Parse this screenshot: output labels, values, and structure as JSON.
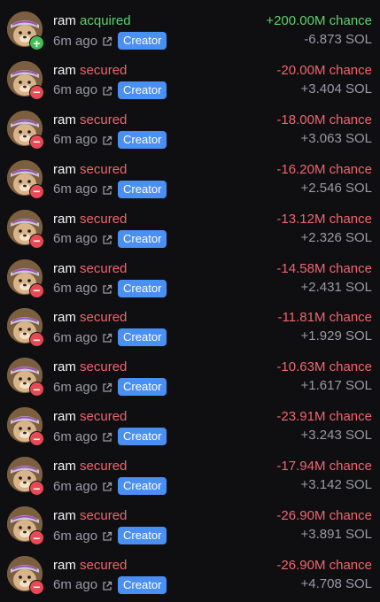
{
  "trades": [
    {
      "user": "ram",
      "action": "acquired",
      "side": "buy",
      "badge": "+",
      "time": "6m ago",
      "tag": "Creator",
      "amount": "+200.00M chance",
      "sol": "-6.873 SOL"
    },
    {
      "user": "ram",
      "action": "secured",
      "side": "sell",
      "badge": "−",
      "time": "6m ago",
      "tag": "Creator",
      "amount": "-20.00M chance",
      "sol": "+3.404 SOL"
    },
    {
      "user": "ram",
      "action": "secured",
      "side": "sell",
      "badge": "−",
      "time": "6m ago",
      "tag": "Creator",
      "amount": "-18.00M chance",
      "sol": "+3.063 SOL"
    },
    {
      "user": "ram",
      "action": "secured",
      "side": "sell",
      "badge": "−",
      "time": "6m ago",
      "tag": "Creator",
      "amount": "-16.20M chance",
      "sol": "+2.546 SOL"
    },
    {
      "user": "ram",
      "action": "secured",
      "side": "sell",
      "badge": "−",
      "time": "6m ago",
      "tag": "Creator",
      "amount": "-13.12M chance",
      "sol": "+2.326 SOL"
    },
    {
      "user": "ram",
      "action": "secured",
      "side": "sell",
      "badge": "−",
      "time": "6m ago",
      "tag": "Creator",
      "amount": "-14.58M chance",
      "sol": "+2.431 SOL"
    },
    {
      "user": "ram",
      "action": "secured",
      "side": "sell",
      "badge": "−",
      "time": "6m ago",
      "tag": "Creator",
      "amount": "-11.81M chance",
      "sol": "+1.929 SOL"
    },
    {
      "user": "ram",
      "action": "secured",
      "side": "sell",
      "badge": "−",
      "time": "6m ago",
      "tag": "Creator",
      "amount": "-10.63M chance",
      "sol": "+1.617 SOL"
    },
    {
      "user": "ram",
      "action": "secured",
      "side": "sell",
      "badge": "−",
      "time": "6m ago",
      "tag": "Creator",
      "amount": "-23.91M chance",
      "sol": "+3.243 SOL"
    },
    {
      "user": "ram",
      "action": "secured",
      "side": "sell",
      "badge": "−",
      "time": "6m ago",
      "tag": "Creator",
      "amount": "-17.94M chance",
      "sol": "+3.142 SOL"
    },
    {
      "user": "ram",
      "action": "secured",
      "side": "sell",
      "badge": "−",
      "time": "6m ago",
      "tag": "Creator",
      "amount": "-26.90M chance",
      "sol": "+3.891 SOL"
    },
    {
      "user": "ram",
      "action": "secured",
      "side": "sell",
      "badge": "−",
      "time": "6m ago",
      "tag": "Creator",
      "amount": "-26.90M chance",
      "sol": "+4.708 SOL"
    }
  ],
  "icons": {
    "avatar": "dog-with-headband-avatar",
    "buy_badge": "plus-icon",
    "sell_badge": "minus-icon",
    "link": "external-link-icon"
  },
  "colors": {
    "background": "#0f0f12",
    "buy": "#5ad26a",
    "sell": "#f0656c",
    "tag": "#4a8ff2",
    "muted": "#9a9aa4"
  }
}
